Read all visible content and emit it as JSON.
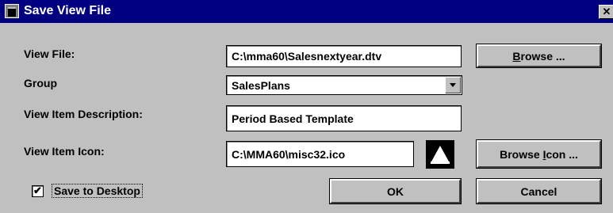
{
  "window": {
    "title": "Save View File",
    "close_glyph": "✕"
  },
  "labels": {
    "view_file": "View File:",
    "group": "Group",
    "description": "View Item Description:",
    "icon": "View Item Icon:"
  },
  "fields": {
    "view_file": "C:\\mma60\\Salesnextyear.dtv",
    "group_selected": "SalesPlans",
    "description": "Period Based Template",
    "icon_path": "C:\\MMA60\\misc32.ico"
  },
  "buttons": {
    "browse_mnemonic": "B",
    "browse_rest": "rowse ...",
    "browse_icon_prefix": "Browse ",
    "browse_icon_mnemonic": "I",
    "browse_icon_rest": "con ...",
    "ok": "OK",
    "cancel": "Cancel"
  },
  "checkbox": {
    "label": "Save to Desktop",
    "checked": true,
    "check_glyph": "✔"
  },
  "icons": {
    "app": "window-app-icon",
    "preview": "bell-icon",
    "dropdown": "chevron-down-icon"
  }
}
